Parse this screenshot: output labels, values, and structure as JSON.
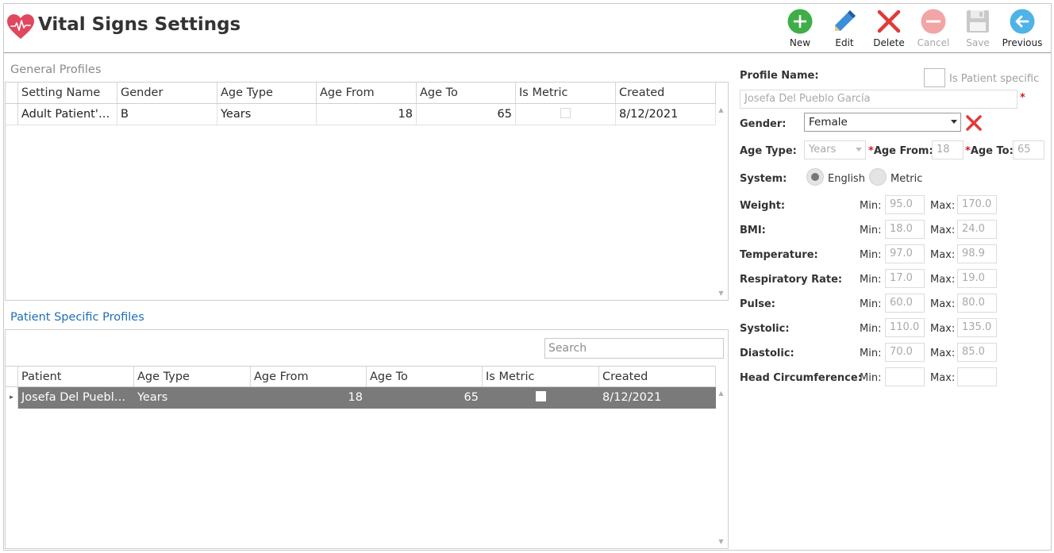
{
  "app": {
    "title": "Vital Signs Settings",
    "accent": "#e0485f"
  },
  "toolbar": {
    "new": "New",
    "edit": "Edit",
    "delete": "Delete",
    "cancel": "Cancel",
    "save": "Save",
    "previous": "Previous"
  },
  "general": {
    "title": "General Profiles",
    "columns": [
      "Setting Name",
      "Gender",
      "Age Type",
      "Age From",
      "Age To",
      "Is Metric",
      "Created"
    ],
    "rows": [
      {
        "setting_name": "Adult Patient's...",
        "gender": "B",
        "age_type": "Years",
        "age_from": "18",
        "age_to": "65",
        "is_metric": false,
        "created": "8/12/2021"
      }
    ]
  },
  "patient_specific": {
    "title": "Patient Specific Profiles",
    "search_placeholder": "Search",
    "columns": [
      "Patient",
      "Age Type",
      "Age From",
      "Age To",
      "Is Metric",
      "Created"
    ],
    "rows": [
      {
        "patient": "Josefa Del Pueblo...",
        "age_type": "Years",
        "age_from": "18",
        "age_to": "65",
        "is_metric": false,
        "created": "8/12/2021",
        "selected": true
      }
    ]
  },
  "form": {
    "profile_name_label": "Profile Name:",
    "is_patient_specific_label": "Is Patient specific",
    "profile_name_value": "Josefa Del Pueblo García",
    "required_mark": "*",
    "gender_label": "Gender:",
    "gender_value": "Female",
    "age_type_label": "Age Type:",
    "age_type_value": "Years",
    "age_from_label": "Age From:",
    "age_from_value": "18",
    "age_to_label": "Age To:",
    "age_to_value": "65",
    "system_label": "System:",
    "system_options": [
      "English",
      "Metric"
    ],
    "system_selected": "English",
    "min_label": "Min:",
    "max_label": "Max:",
    "vitals": [
      {
        "label": "Weight:",
        "min": "95.0",
        "max": "170.0"
      },
      {
        "label": "BMI:",
        "min": "18.0",
        "max": "24.0"
      },
      {
        "label": "Temperature:",
        "min": "97.0",
        "max": "98.9"
      },
      {
        "label": "Respiratory Rate:",
        "min": "17.0",
        "max": "19.0"
      },
      {
        "label": "Pulse:",
        "min": "60.0",
        "max": "80.0"
      },
      {
        "label": "Systolic:",
        "min": "110.0",
        "max": "135.0"
      },
      {
        "label": "Diastolic:",
        "min": "70.0",
        "max": "85.0"
      },
      {
        "label": "Head Circumference:",
        "min": "",
        "max": ""
      }
    ]
  }
}
